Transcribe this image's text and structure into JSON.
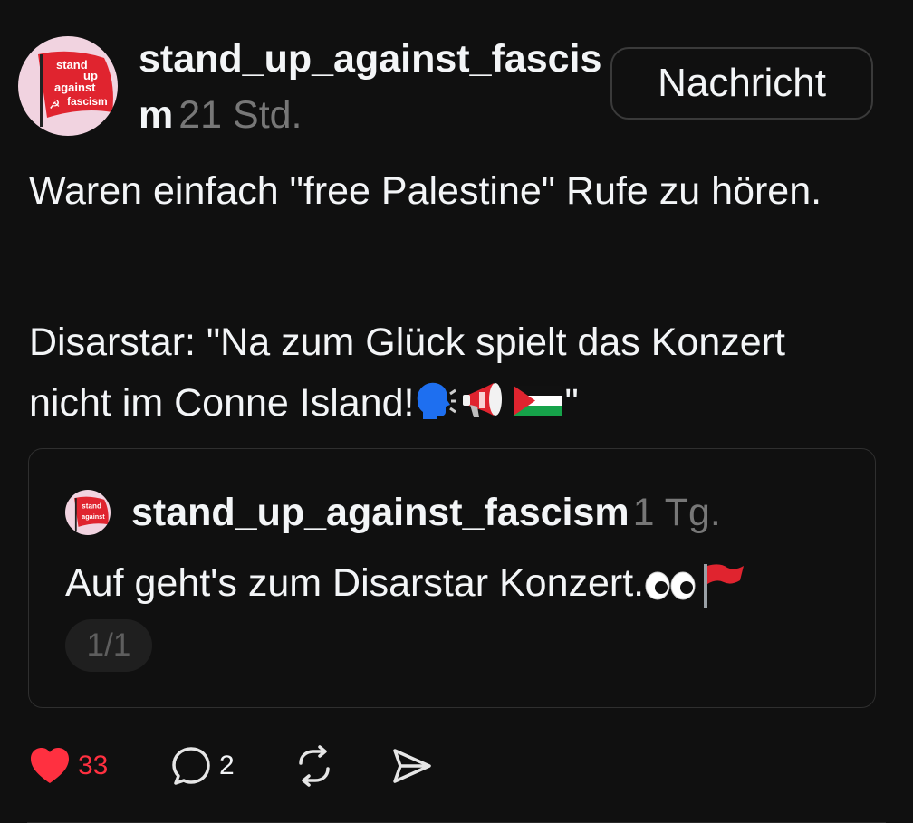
{
  "post": {
    "username": "stand_up_against_fascism",
    "timestamp": "21 Std.",
    "message_button": "Nachricht",
    "paragraph1": "Waren einfach \"free Palestine\" Rufe zu hören.",
    "paragraph2_text": "Disarstar: \"Na zum Glück spielt das Konzert nicht im Conne Island!",
    "paragraph2_end": "\""
  },
  "avatar_logo": {
    "line1": "stand",
    "line2": "up",
    "line3": "against",
    "line4": "fascism",
    "flag_color": "#e0242f",
    "background": "#f1d3e0"
  },
  "quote": {
    "username": "stand_up_against_fascism",
    "timestamp": "1 Tg.",
    "text": "Auf geht's zum Disarstar Konzert.",
    "pager": "1/1"
  },
  "actions": {
    "likes": "33",
    "replies": "2",
    "like_color": "#ff3040"
  },
  "icons": [
    "heart-icon",
    "comment-icon",
    "repost-icon",
    "share-icon",
    "speaking-head-emoji",
    "megaphone-emoji",
    "palestine-flag-emoji",
    "eyes-emoji",
    "red-flag-emoji"
  ]
}
